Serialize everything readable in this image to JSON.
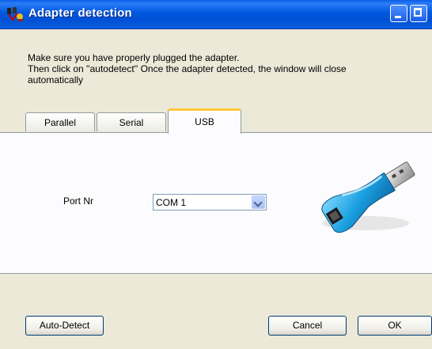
{
  "window": {
    "title": "Adapter detection"
  },
  "instructions": {
    "line1": "Make sure you have properly plugged the adapter.",
    "line2": "Then click on ''autodetect'' Once the adapter detected, the window will close",
    "line3": "automatically"
  },
  "tabs": [
    {
      "label": "Parallel",
      "selected": false
    },
    {
      "label": "Serial",
      "selected": false
    },
    {
      "label": "USB",
      "selected": true
    }
  ],
  "usb_panel": {
    "port_label": "Port Nr",
    "port_value": "COM 1"
  },
  "buttons": {
    "autodetect": "Auto-Detect",
    "cancel": "Cancel",
    "ok": "OK"
  },
  "colors": {
    "titlebar": "#0054e3",
    "accent_tab": "#ffc83c",
    "dialog_bg": "#ece9d8"
  },
  "icons": {
    "app": "adapter-plug-icon",
    "minimize": "minimize-icon",
    "maximize": "maximize-icon",
    "dropdown": "chevron-down-icon",
    "usb": "usb-adapter-image"
  }
}
